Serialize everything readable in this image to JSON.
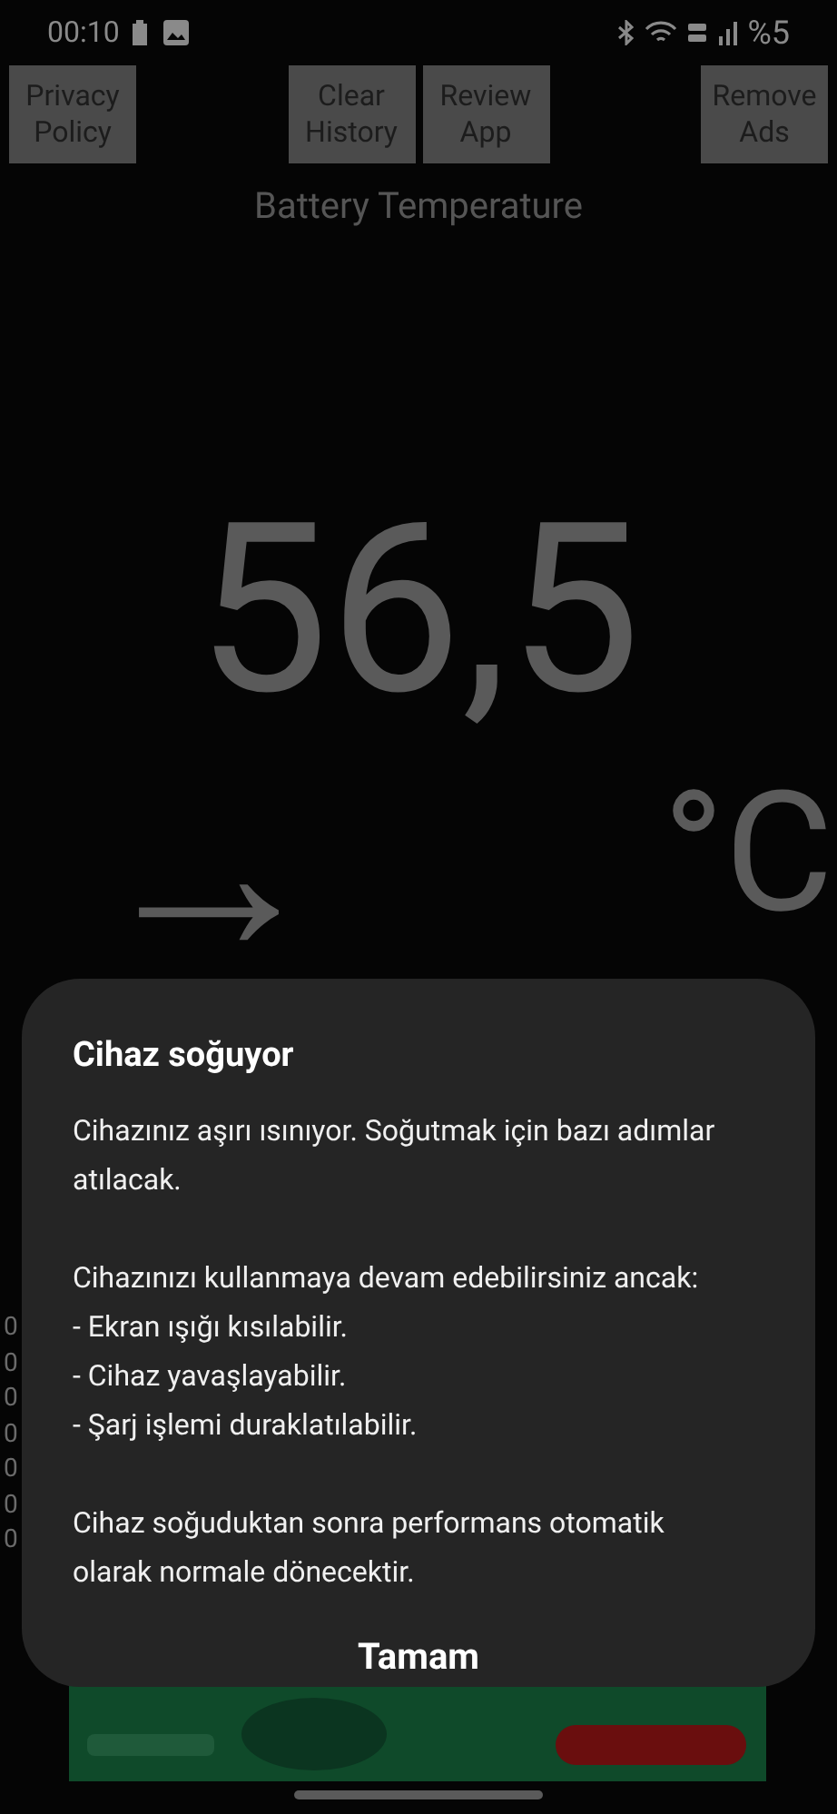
{
  "status_bar": {
    "time": "00:10",
    "battery": "%5"
  },
  "toolbar": {
    "buttons": [
      {
        "label": "Privacy\nPolicy"
      },
      {
        "label": "Clear\nHistory"
      },
      {
        "label": "Review\nApp"
      },
      {
        "label": "Remove\nAds"
      }
    ]
  },
  "title": "Battery Temperature",
  "reading": {
    "value": "56,5",
    "trend": "→",
    "unit": "°C"
  },
  "history": [
    "0",
    "0",
    "0",
    "0",
    "0",
    "0",
    "0"
  ],
  "dialog": {
    "title": "Cihaz soğuyor",
    "paragraphs": [
      "Cihazınız aşırı ısınıyor. Soğutmak için bazı adımlar atılacak.",
      "Cihazınızı kullanmaya devam edebilirsiniz ancak:\n- Ekran ışığı kısılabilir.\n- Cihaz yavaşlayabilir.\n- Şarj işlemi duraklatılabilir.",
      "Cihaz soğuduktan sonra performans otomatik olarak normale dönecektir."
    ],
    "button": "Tamam"
  }
}
